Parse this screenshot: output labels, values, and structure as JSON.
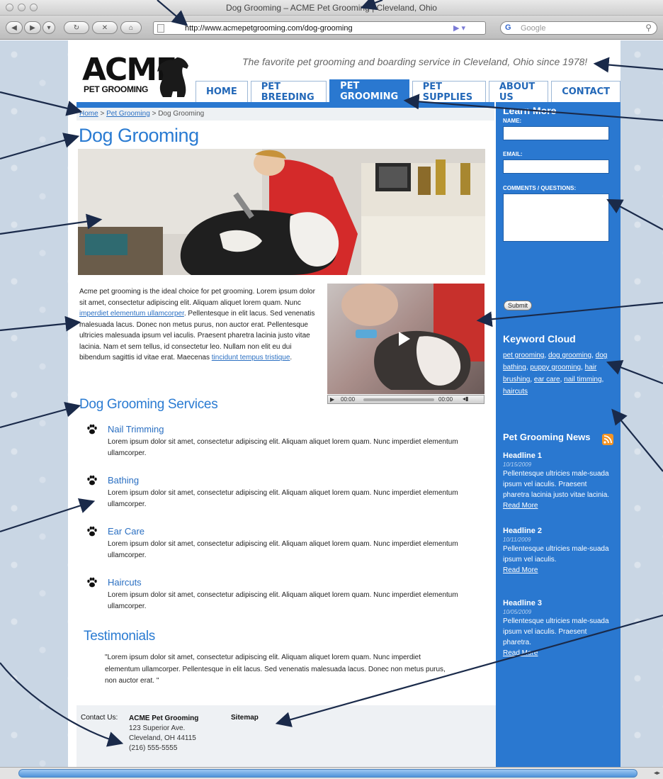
{
  "browser": {
    "window_title": "Dog Grooming – ACME Pet Grooming | Cleveland, Ohio",
    "url": "http://www.acmepetgrooming.com/dog-grooming",
    "search_placeholder": "Google",
    "search_engine_letter": "G"
  },
  "header": {
    "logo_big": "ACME",
    "logo_small": "PET GROOMING",
    "tagline": "The favorite pet grooming and boarding service in Cleveland, Ohio since 1978!"
  },
  "nav": {
    "tabs": [
      "HOME",
      "PET BREEDING",
      "PET GROOMING",
      "PET SUPPLIES",
      "ABOUT US",
      "CONTACT"
    ],
    "active": "PET GROOMING"
  },
  "breadcrumb": {
    "home": "Home",
    "sep1": ">",
    "section": "Pet Grooming",
    "sep2": ">",
    "current": "Dog Grooming"
  },
  "main": {
    "title": "Dog Grooming",
    "intro_1": "Acme pet grooming is the ideal choice for pet grooming.  Lorem ipsum dolor sit amet, consectetur adipiscing elit. Aliquam aliquet lorem quam. Nunc ",
    "intro_link_1": "imperdiet elementum ullamcorper",
    "intro_2": ". Pellentesque in elit lacus. Sed venenatis malesuada lacus. Donec non metus purus, non auctor erat. Pellentesque ultricies malesuada ipsum vel iaculis. Praesent pharetra lacinia justo vitae lacinia. Nam et sem tellus, id consectetur leo. Nullam non elit eu dui bibendum sagittis id vitae erat. Maecenas ",
    "intro_link_2": "tincidunt tempus tristique",
    "intro_3": ".",
    "video_time_start": "00:00",
    "video_time_end": "00:00",
    "services_title": "Dog Grooming Services",
    "services": [
      {
        "name": "Nail Trimming",
        "desc": "Lorem ipsum dolor sit amet, consectetur adipiscing elit. Aliquam aliquet lorem quam. Nunc imperdiet elementum ullamcorper."
      },
      {
        "name": "Bathing",
        "desc": "Lorem ipsum dolor sit amet, consectetur adipiscing elit. Aliquam aliquet lorem quam. Nunc imperdiet elementum ullamcorper."
      },
      {
        "name": "Ear Care",
        "desc": "Lorem ipsum dolor sit amet, consectetur adipiscing elit. Aliquam aliquet lorem quam. Nunc imperdiet elementum ullamcorper."
      },
      {
        "name": "Haircuts",
        "desc": "Lorem ipsum dolor sit amet, consectetur adipiscing elit. Aliquam aliquet lorem quam. Nunc imperdiet elementum ullamcorper."
      }
    ],
    "testimonials_title": "Testimonials",
    "testimonial": "\"Lorem ipsum dolor sit amet, consectetur adipiscing elit. Aliquam aliquet lorem quam. Nunc imperdiet elementum ullamcorper. Pellentesque in elit lacus. Sed venenatis malesuada lacus. Donec non metus purus, non auctor erat. \""
  },
  "footer": {
    "contact_label": "Contact Us:",
    "name": "ACME Pet Grooming",
    "street": "123 Superior Ave.",
    "city": "Cleveland, OH 44115",
    "phone": "(216) 555-5555",
    "sitemap": "Sitemap"
  },
  "sidebar": {
    "learn_more": "Learn More",
    "name_label": "NAME:",
    "email_label": "EMAIL:",
    "comments_label": "COMMENTS / QUESTIONS:",
    "submit": "Submit",
    "keyword_title": "Keyword Cloud",
    "keywords": [
      "pet grooming",
      "dog grooming",
      "dog bathing",
      "puppy grooming",
      "hair brushing",
      "ear care",
      "nail timming",
      "haircuts"
    ],
    "news_title": "Pet Grooming News",
    "news": [
      {
        "headline": "Headline 1",
        "date": "10/15/2009",
        "text": "Pellentesque ultricies male-suada ipsum vel iaculis. Praesent pharetra lacinia justo vitae lacinia.",
        "more": "Read More"
      },
      {
        "headline": "Headline 2",
        "date": "10/11/2009",
        "text": "Pellentesque ultricies male-suada ipsum vel iaculis.",
        "more": "Read More"
      },
      {
        "headline": "Headline 3",
        "date": "10/05/2009",
        "text": "Pellentesque ultricies male-suada ipsum vel iaculis. Praesent pharetra.",
        "more": "Read More"
      }
    ]
  },
  "colors": {
    "brand_blue": "#2a78d0",
    "link_blue": "#2a6fc2",
    "page_bg": "#c9d6e4",
    "annotation_arrow": "#1a2a4a",
    "rss_orange": "#f39425"
  },
  "icons": {
    "back": "back-arrow-icon",
    "forward": "forward-arrow-icon",
    "reload": "reload-icon",
    "stop": "stop-icon",
    "home": "home-icon",
    "service_bullet": "paw-icon",
    "news_feed": "rss-icon",
    "video_play": "play-icon"
  }
}
